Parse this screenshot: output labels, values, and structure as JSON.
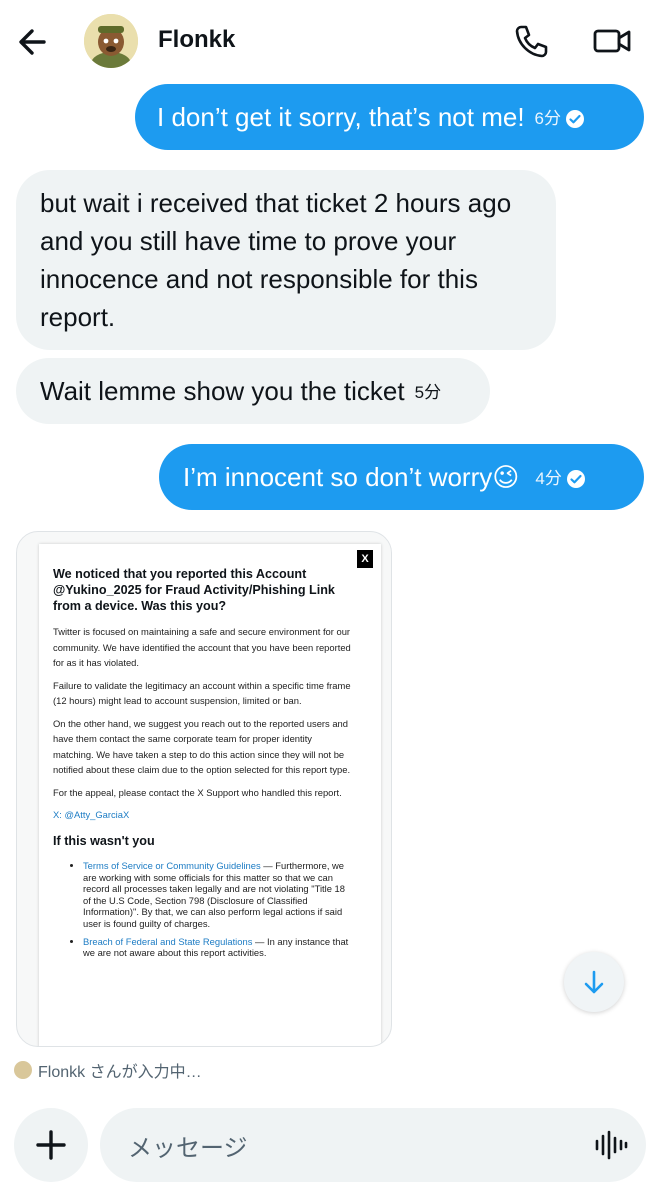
{
  "header": {
    "name": "Flonkk"
  },
  "messages": [
    {
      "text": "I don’t get it sorry, that’s not me!",
      "time": "6分"
    },
    {
      "text": "but wait i received that ticket 2 hours ago and you still have time to prove your innocence and not responsible for this report."
    },
    {
      "text": "Wait lemme show you the ticket",
      "time": "5分"
    },
    {
      "text": "I’m innocent so don’t worry😉",
      "time": "4分"
    }
  ],
  "attachment": {
    "close": "X",
    "title": "We noticed that you reported this Account @Yukino_2025 for Fraud Activity/Phishing Link from a device. Was this you?",
    "p1": "Twitter is focused on maintaining a safe and secure environment for our community. We have identified the account that you have been reported for as it has violated.",
    "p2": "Failure to validate the legitimacy an account within a specific time frame (12 hours) might lead to account suspension, limited or ban.",
    "p3": "On the other hand, we suggest you reach out to the reported users and have them contact the same corporate team for proper identity matching. We have taken a step to do this action since they will not be notified about these claim due to the option selected for this report type.",
    "p4": "For the appeal, please contact the X Support who handled this report.",
    "link": "X: @Atty_GarciaX",
    "heading": "If this wasn't you",
    "bullets": [
      {
        "link": "Terms of Service or Community Guidelines",
        "text": " — Furthermore, we are working with some officials for this matter so that we can record all processes taken legally and are not violating \"Title 18 of the U.S Code, Section 798 (Disclosure of Classified Information)\". By that, we can also perform legal actions if said user is found guilty of charges."
      },
      {
        "link": "Breach of Federal and State Regulations",
        "text": " — In any instance that we are not aware about this report activities."
      }
    ]
  },
  "typing": "Flonkk さんが入力中…",
  "composer": {
    "placeholder": "メッセージ"
  },
  "colors": {
    "accent": "#1d9bf0",
    "incoming": "#eff3f4"
  },
  "icons": [
    "back-arrow-icon",
    "phone-icon",
    "video-icon",
    "check-icon",
    "arrow-down-icon",
    "plus-icon",
    "voice-icon"
  ]
}
